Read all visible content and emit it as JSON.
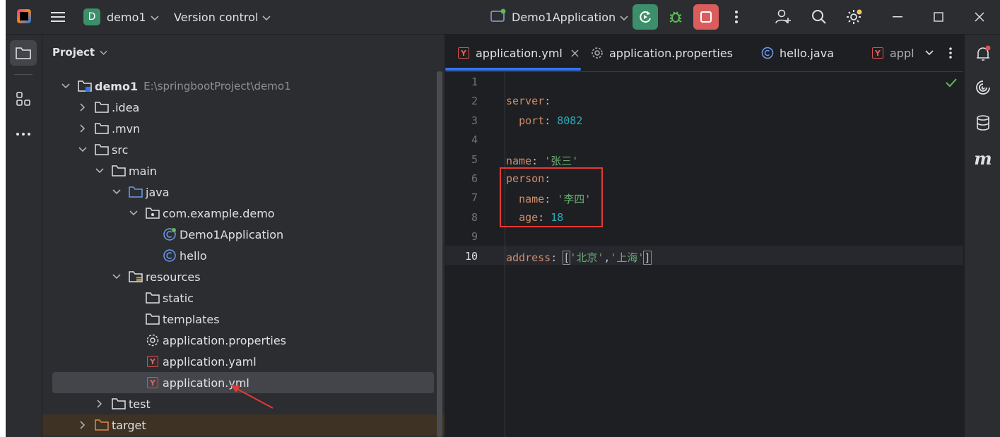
{
  "titlebar": {
    "project_badge": "D",
    "project_name": "demo1",
    "vcs_label": "Version control",
    "run_config": "Demo1Application",
    "accent_run": "#3b8f6a",
    "accent_stop": "#db5c5c"
  },
  "project_panel": {
    "header": "Project",
    "tree": [
      {
        "label": "demo1",
        "path": "E:\\springbootProject\\demo1",
        "icon": "module-folder-icon",
        "expanded": true
      },
      {
        "label": ".idea",
        "icon": "folder-icon",
        "expanded": false
      },
      {
        "label": ".mvn",
        "icon": "folder-icon",
        "expanded": false
      },
      {
        "label": "src",
        "icon": "folder-icon",
        "expanded": true
      },
      {
        "label": "main",
        "icon": "folder-icon",
        "expanded": true
      },
      {
        "label": "java",
        "icon": "source-folder-icon",
        "expanded": true
      },
      {
        "label": "com.example.demo",
        "icon": "package-icon",
        "expanded": true
      },
      {
        "label": "Demo1Application",
        "icon": "spring-class-icon"
      },
      {
        "label": "hello",
        "icon": "class-icon"
      },
      {
        "label": "resources",
        "icon": "resources-folder-icon",
        "expanded": true
      },
      {
        "label": "static",
        "icon": "folder-icon"
      },
      {
        "label": "templates",
        "icon": "folder-icon"
      },
      {
        "label": "application.properties",
        "icon": "gear-icon"
      },
      {
        "label": "application.yaml",
        "icon": "yaml-icon"
      },
      {
        "label": "application.yml",
        "icon": "yaml-icon",
        "selected": true
      },
      {
        "label": "test",
        "icon": "folder-icon",
        "expanded": false
      },
      {
        "label": "target",
        "icon": "excluded-folder-icon",
        "expanded": false
      }
    ]
  },
  "editor": {
    "tabs": [
      {
        "label": "application.yml",
        "icon": "yaml-icon",
        "active": true
      },
      {
        "label": "application.properties",
        "icon": "gear-icon"
      },
      {
        "label": "hello.java",
        "icon": "class-icon"
      },
      {
        "label": "appl",
        "icon": "yaml-icon"
      }
    ],
    "line_numbers": [
      "1",
      "2",
      "3",
      "4",
      "5",
      "6",
      "7",
      "8",
      "9",
      "10"
    ],
    "code_lines": [
      [],
      [
        {
          "t": "server",
          "c": "k"
        },
        {
          "t": ":",
          "c": "p"
        }
      ],
      [
        {
          "t": "  ",
          "c": "p"
        },
        {
          "t": "port",
          "c": "k"
        },
        {
          "t": ": ",
          "c": "p"
        },
        {
          "t": "8082",
          "c": "n"
        }
      ],
      [],
      [
        {
          "t": "name",
          "c": "k"
        },
        {
          "t": ": ",
          "c": "p"
        },
        {
          "t": "'张三'",
          "c": "s"
        }
      ],
      [
        {
          "t": "person",
          "c": "k"
        },
        {
          "t": ":",
          "c": "p"
        }
      ],
      [
        {
          "t": "  ",
          "c": "p"
        },
        {
          "t": "name",
          "c": "k"
        },
        {
          "t": ": ",
          "c": "p"
        },
        {
          "t": "'李四'",
          "c": "s"
        }
      ],
      [
        {
          "t": "  ",
          "c": "p"
        },
        {
          "t": "age",
          "c": "k"
        },
        {
          "t": ": ",
          "c": "p"
        },
        {
          "t": "18",
          "c": "n"
        }
      ],
      [],
      [
        {
          "t": "address",
          "c": "k"
        },
        {
          "t": ": ",
          "c": "p"
        },
        {
          "t": "[",
          "c": "p"
        },
        {
          "t": "'北京'",
          "c": "s"
        },
        {
          "t": ",",
          "c": "p"
        },
        {
          "t": "'上海'",
          "c": "s"
        },
        {
          "t": "]",
          "c": "p"
        }
      ]
    ],
    "current_line": "10"
  }
}
